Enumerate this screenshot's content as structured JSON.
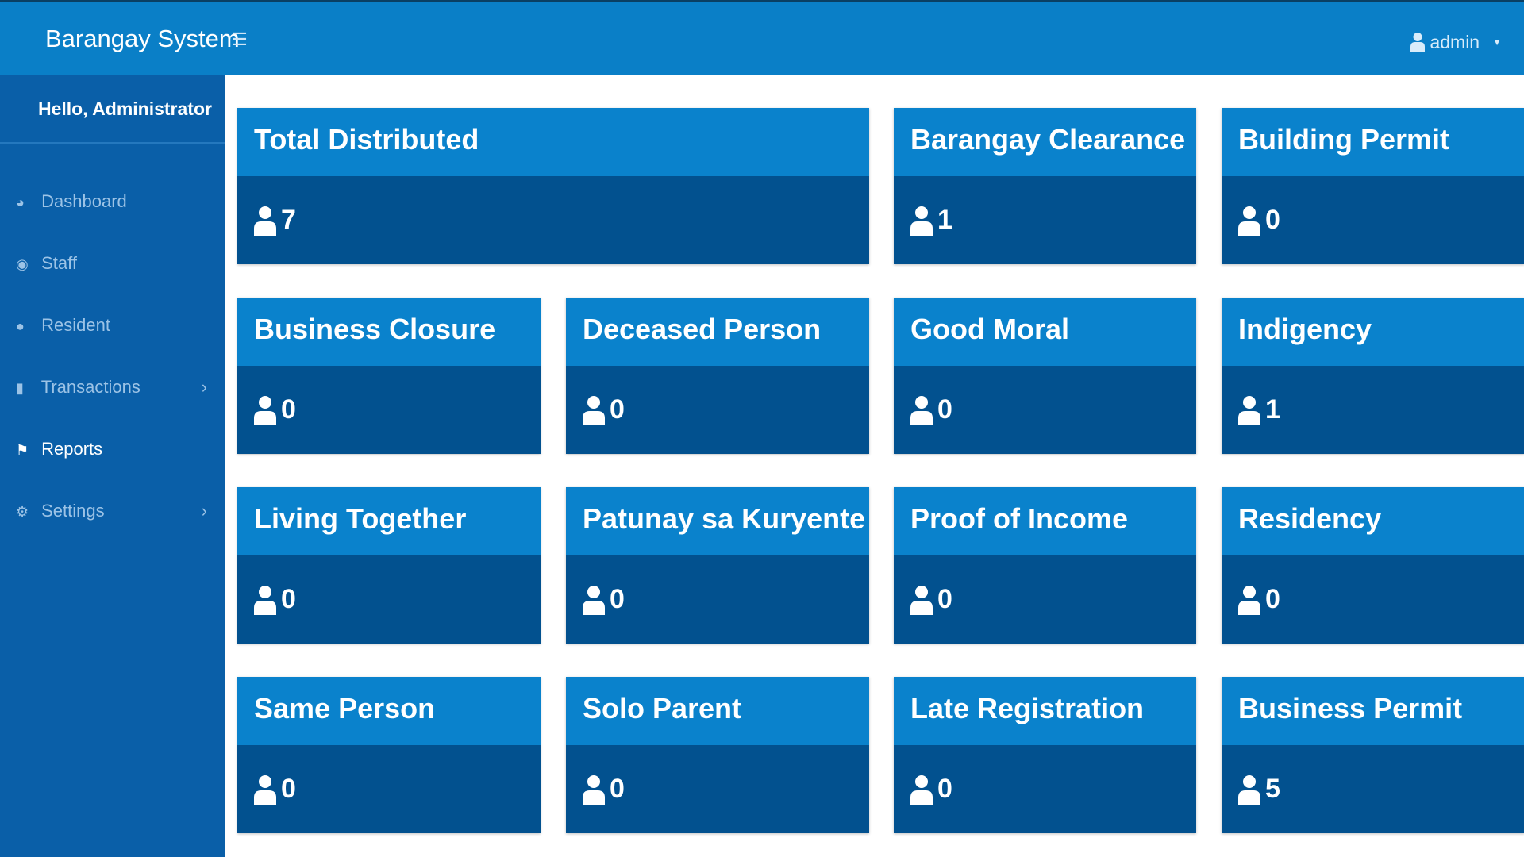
{
  "header": {
    "brand": "Barangay System",
    "menu_icon": "hamburger-icon",
    "user_label": "admin",
    "user_icon": "user-icon"
  },
  "sidebar": {
    "greeting": "Hello, Administrator",
    "items": [
      {
        "label": "Dashboard",
        "icon": "dashboard-icon",
        "active": false,
        "submenu": false
      },
      {
        "label": "Staff",
        "icon": "user-circle-icon",
        "active": false,
        "submenu": false
      },
      {
        "label": "Resident",
        "icon": "users-icon",
        "active": false,
        "submenu": false
      },
      {
        "label": "Transactions",
        "icon": "file-icon",
        "active": false,
        "submenu": true
      },
      {
        "label": "Reports",
        "icon": "flag-icon",
        "active": true,
        "submenu": false
      },
      {
        "label": "Settings",
        "icon": "gear-icon",
        "active": false,
        "submenu": true
      }
    ]
  },
  "cards": [
    {
      "title": "Total Distributed",
      "count": "7"
    },
    {
      "title": "Barangay Clearance",
      "count": "1"
    },
    {
      "title": "Building Permit",
      "count": "0"
    },
    {
      "title": "Business Closure",
      "count": "0"
    },
    {
      "title": "Deceased Person",
      "count": "0"
    },
    {
      "title": "Good Moral",
      "count": "0"
    },
    {
      "title": "Indigency",
      "count": "1"
    },
    {
      "title": "Living Together",
      "count": "0"
    },
    {
      "title": "Patunay sa Kuryente",
      "count": "0"
    },
    {
      "title": "Proof of Income",
      "count": "0"
    },
    {
      "title": "Residency",
      "count": "0"
    },
    {
      "title": "Same Person",
      "count": "0"
    },
    {
      "title": "Solo Parent",
      "count": "0"
    },
    {
      "title": "Late Registration",
      "count": "0"
    },
    {
      "title": "Business Permit",
      "count": "5"
    }
  ],
  "colors": {
    "topbar": "#0a7fc7",
    "sidebar": "#0a5fa8",
    "card_header": "#0a82cc",
    "card_body": "#02518f"
  }
}
